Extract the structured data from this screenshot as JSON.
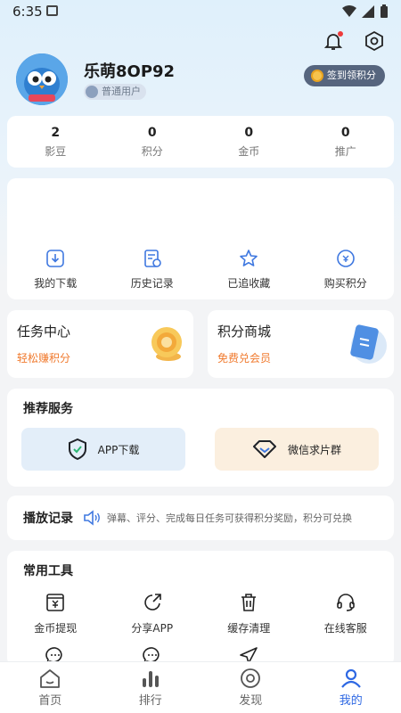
{
  "status_bar": {
    "time": "6:35"
  },
  "profile": {
    "username": "乐萌8OP92",
    "level": "普通用户",
    "checkin_label": "签到领积分"
  },
  "stats": [
    {
      "value": "2",
      "label": "影豆"
    },
    {
      "value": "0",
      "label": "积分"
    },
    {
      "value": "0",
      "label": "金币"
    },
    {
      "value": "0",
      "label": "推广"
    }
  ],
  "actions": [
    {
      "label": "我的下载",
      "icon": "download-icon"
    },
    {
      "label": "历史记录",
      "icon": "history-icon"
    },
    {
      "label": "已追收藏",
      "icon": "star-icon"
    },
    {
      "label": "购买积分",
      "icon": "buy-points-icon"
    }
  ],
  "promos": [
    {
      "title": "任务中心",
      "subtitle": "轻松赚积分"
    },
    {
      "title": "积分商城",
      "subtitle": "免费兑会员"
    }
  ],
  "services": {
    "title": "推荐服务",
    "items": [
      {
        "label": "APP下载",
        "icon": "shield-check-icon"
      },
      {
        "label": "微信求片群",
        "icon": "diamond-icon"
      }
    ]
  },
  "history": {
    "title": "播放记录",
    "notice": "弹幕、评分、完成每日任务可获得积分奖励，积分可兑换"
  },
  "tools": {
    "title": "常用工具",
    "items": [
      {
        "label": "金币提现",
        "icon": "withdraw-icon"
      },
      {
        "label": "分享APP",
        "icon": "share-icon"
      },
      {
        "label": "缓存清理",
        "icon": "trash-icon"
      },
      {
        "label": "在线客服",
        "icon": "headset-icon"
      },
      {
        "label": "",
        "icon": "chat-icon"
      },
      {
        "label": "",
        "icon": "message-icon"
      },
      {
        "label": "",
        "icon": "send-icon"
      }
    ]
  },
  "nav": [
    {
      "label": "首页",
      "icon": "home-icon"
    },
    {
      "label": "排行",
      "icon": "ranking-icon"
    },
    {
      "label": "发现",
      "icon": "discover-icon"
    },
    {
      "label": "我的",
      "icon": "profile-icon",
      "active": true
    }
  ],
  "colors": {
    "accent": "#2e68e3",
    "orange": "#f07a2e",
    "badge_bg": "#56657e"
  }
}
